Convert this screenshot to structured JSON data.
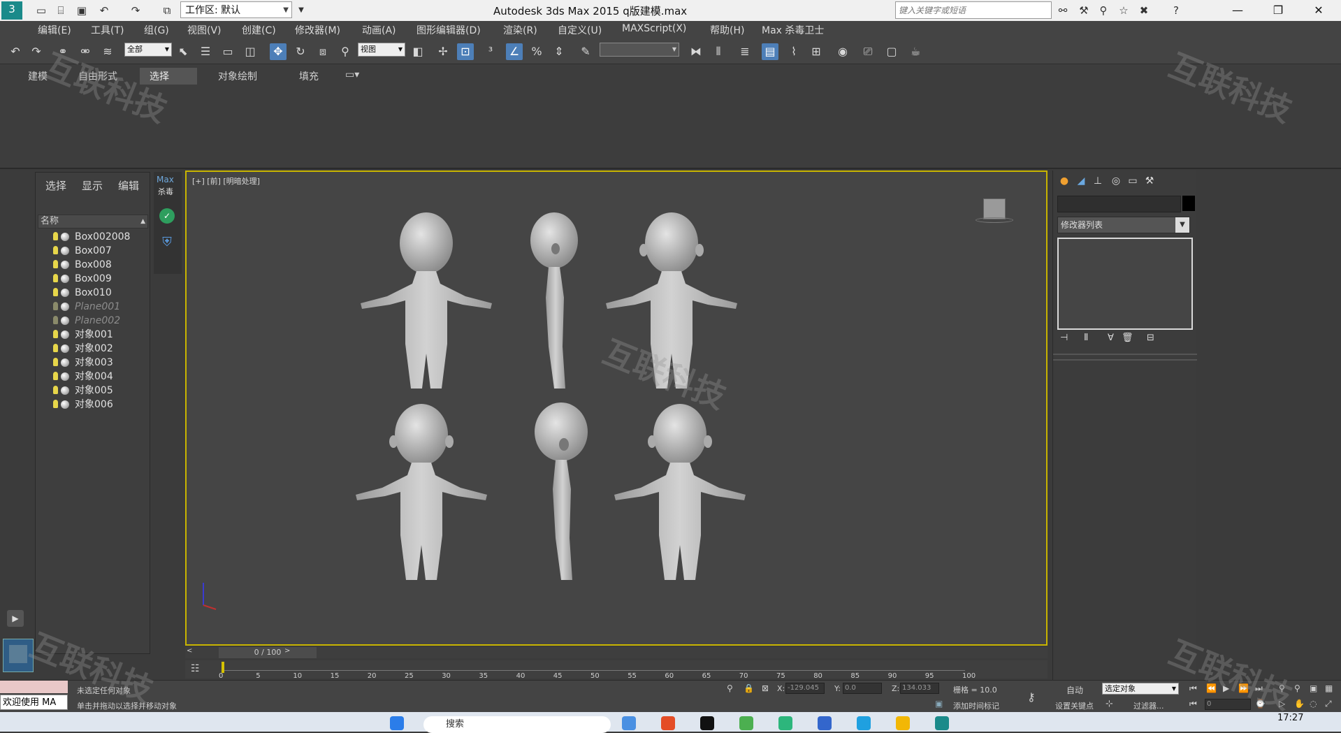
{
  "titlebar": {
    "workspace_label": "工作区: 默认",
    "window_title": "Autodesk 3ds Max  2015      q版建模.max",
    "search_placeholder": "键入关键字或短语",
    "minimize": "—",
    "restore": "❐",
    "close": "✕"
  },
  "menubar": [
    "编辑(E)",
    "工具(T)",
    "组(G)",
    "视图(V)",
    "创建(C)",
    "修改器(M)",
    "动画(A)",
    "图形编辑器(D)",
    "渲染(R)",
    "自定义(U)",
    "MAXScript(X)",
    "帮助(H)",
    "Max 杀毒卫士"
  ],
  "toolbar": {
    "selection_filter": "全部",
    "coord_system": "视图",
    "named_selection": ""
  },
  "ribbon": {
    "tabs": [
      "建模",
      "自由形式",
      "选择",
      "对象绘制",
      "填充"
    ],
    "active_tab": "选择"
  },
  "scene_explorer": {
    "tabs": [
      "选择",
      "显示",
      "编辑"
    ],
    "column_header": "名称",
    "objects": [
      {
        "name": "Box002008",
        "hidden": false
      },
      {
        "name": "Box007",
        "hidden": false
      },
      {
        "name": "Box008",
        "hidden": false
      },
      {
        "name": "Box009",
        "hidden": false
      },
      {
        "name": "Box010",
        "hidden": false
      },
      {
        "name": "Plane001",
        "hidden": true
      },
      {
        "name": "Plane002",
        "hidden": true
      },
      {
        "name": "对象001",
        "hidden": false
      },
      {
        "name": "对象002",
        "hidden": false
      },
      {
        "name": "对象003",
        "hidden": false
      },
      {
        "name": "对象004",
        "hidden": false
      },
      {
        "name": "对象005",
        "hidden": false
      },
      {
        "name": "对象006",
        "hidden": false
      }
    ]
  },
  "max_antivirus": {
    "label_line1": "Max",
    "label_line2": "杀毒"
  },
  "viewport": {
    "label": "[+] [前] [明暗处理]"
  },
  "command_panel": {
    "modifier_list": "修改器列表"
  },
  "timeline": {
    "frame_label": "0 / 100",
    "ticks": [
      "0",
      "5",
      "10",
      "15",
      "20",
      "25",
      "30",
      "35",
      "40",
      "45",
      "50",
      "55",
      "60",
      "65",
      "70",
      "75",
      "80",
      "85",
      "90",
      "95",
      "100"
    ]
  },
  "status": {
    "welcome": "欢迎使用 MA",
    "line1": "未选定任何对象",
    "line2": "单击并拖动以选择并移动对象",
    "x_value": "-129.045",
    "y_value": "0.0",
    "z_value": "134.033",
    "grid": "栅格 = 10.0",
    "add_time_tag": "添加时间标记",
    "auto": "自动",
    "selected_set": "选定对象",
    "set_key": "设置关键点",
    "filters": "过滤器...",
    "current_frame": "0"
  },
  "taskbar": {
    "search": "搜索",
    "time": "17:27"
  },
  "watermark": "互联科技"
}
